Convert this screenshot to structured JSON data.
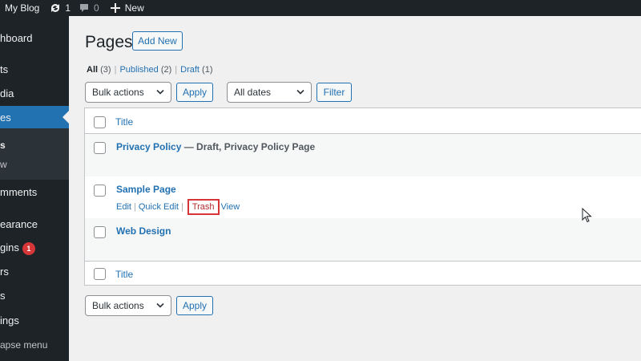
{
  "adminbar": {
    "site_name": "My Blog",
    "updates_count": "1",
    "comments_count": "0",
    "new_label": "New"
  },
  "sidebar": {
    "items": [
      {
        "label": "hboard",
        "full": "Dashboard"
      },
      {
        "label": "ts",
        "full": "Posts"
      },
      {
        "label": "dia",
        "full": "Media"
      },
      {
        "label": "es",
        "full": "Pages"
      },
      {
        "label": "s",
        "full": "All Pages"
      },
      {
        "label": "w",
        "full": "Add New"
      },
      {
        "label": "mments",
        "full": "Comments"
      },
      {
        "label": "earance",
        "full": "Appearance"
      },
      {
        "label": "gins",
        "full": "Plugins"
      },
      {
        "label": "rs",
        "full": "Users"
      },
      {
        "label": "s",
        "full": "Tools"
      },
      {
        "label": "ings",
        "full": "Settings"
      },
      {
        "label": "apse menu",
        "full": "Collapse menu"
      }
    ],
    "plugins_badge": "1"
  },
  "page": {
    "title": "Pages",
    "add_new_label": "Add New"
  },
  "filters": {
    "all_label": "All",
    "all_count": "(3)",
    "published_label": "Published",
    "published_count": "(2)",
    "draft_label": "Draft",
    "draft_count": "(1)",
    "separator": "|"
  },
  "actions": {
    "bulk_actions_label": "Bulk actions",
    "apply_label": "Apply",
    "dates_label": "All dates",
    "filter_label": "Filter"
  },
  "table": {
    "column_title": "Title",
    "rows": [
      {
        "title": "Privacy Policy",
        "state": " — Draft, Privacy Policy Page"
      },
      {
        "title": "Sample Page",
        "state": ""
      },
      {
        "title": "Web Design",
        "state": ""
      }
    ],
    "row_actions": {
      "edit": "Edit",
      "quick_edit": "Quick Edit",
      "trash": "Trash",
      "view": "View",
      "separator": "|"
    }
  },
  "colors": {
    "admin_bg": "#1d2327",
    "accent": "#2271b1",
    "trash": "#b32d2e",
    "highlight_box": "#d63638",
    "badge": "#d63638"
  }
}
